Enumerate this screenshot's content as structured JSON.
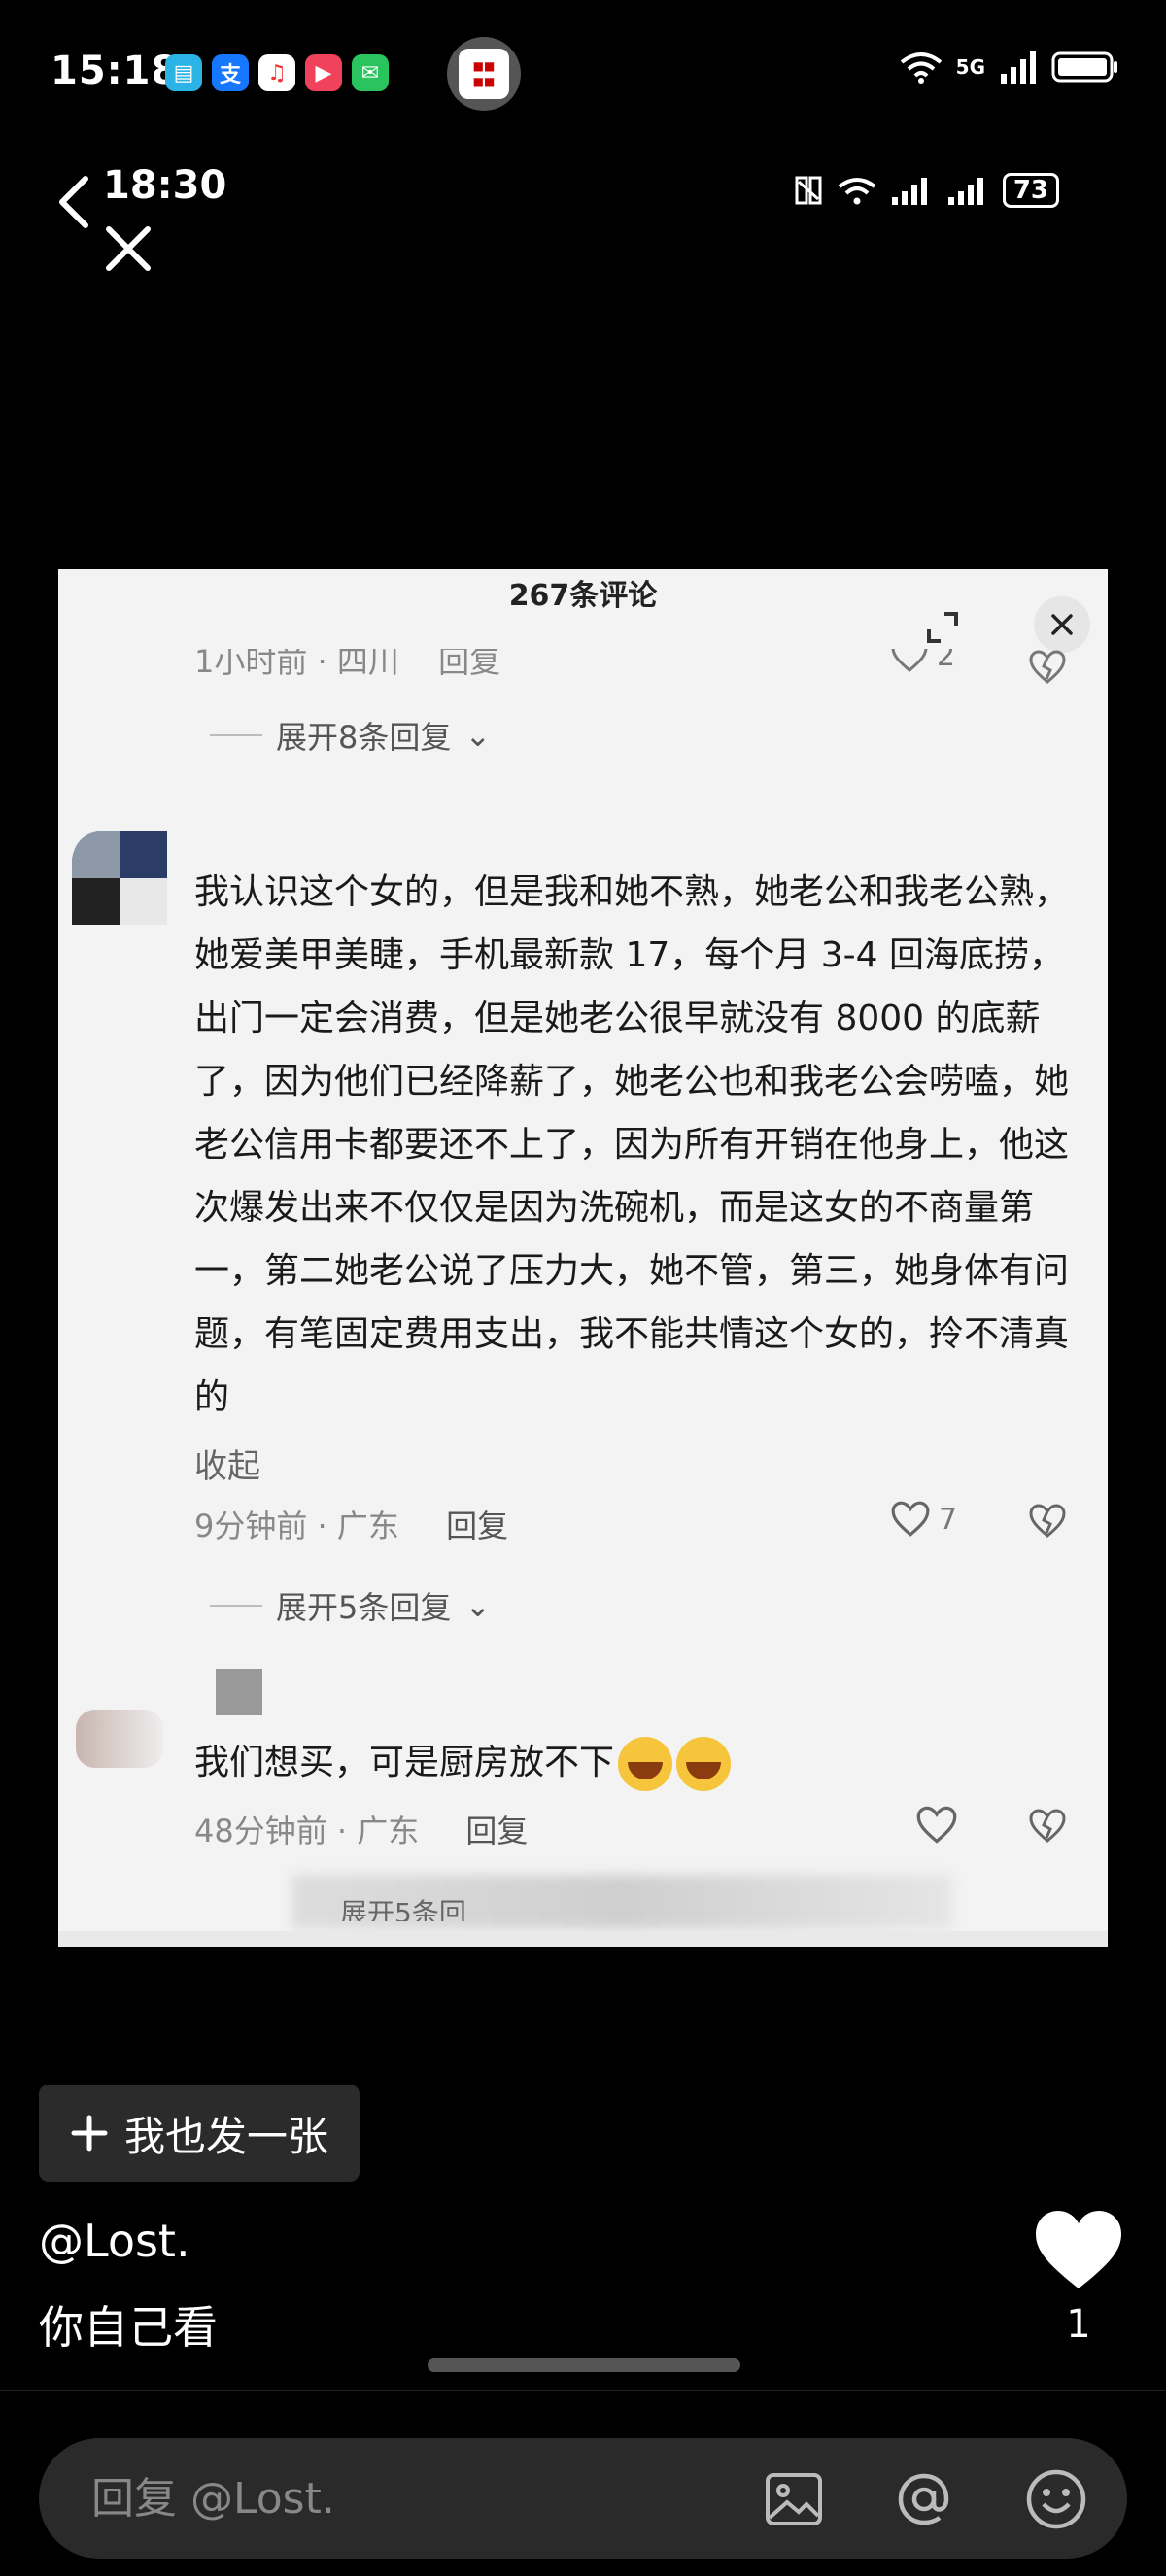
{
  "status_bar": {
    "time": "15:18",
    "network": "5G"
  },
  "photo": {
    "inner_status": {
      "time": "18:30",
      "battery": "73"
    },
    "panel": {
      "title": "267条评论",
      "top_meta": {
        "time_location": "1小时前 · 四川",
        "reply": "回复",
        "likes": "2"
      },
      "expand1": "展开8条回复",
      "comment1": {
        "text": "我认识这个女的，但是我和她不熟，她老公和我老公熟，她爱美甲美睫，手机最新款 17，每个月 3-4 回海底捞，出门一定会消费，但是她老公很早就没有 8000 的底薪了，因为他们已经降薪了，她老公也和我老公会唠嗑，她老公信用卡都要还不上了，因为所有开销在他身上，他这次爆发出来不仅仅是因为洗碗机，而是这女的不商量第一，第二她老公说了压力大，她不管，第三，她身体有问题，有笔固定费用支出，我不能共情这个女的，拎不清真的",
        "collapse": "收起",
        "time_location": "9分钟前 · 广东",
        "reply": "回复",
        "likes": "7"
      },
      "expand2": "展开5条回复",
      "comment2": {
        "text": "我们想买，可是厨房放不下",
        "time_location": "48分钟前 · 广东",
        "reply": "回复"
      },
      "partial_expand": "展开5条回"
    }
  },
  "post_button": {
    "label": "我也发一张"
  },
  "post": {
    "username": "@Lost.",
    "caption": "你自己看",
    "like_count": "1"
  },
  "reply_bar": {
    "placeholder": "回复 @Lost."
  }
}
